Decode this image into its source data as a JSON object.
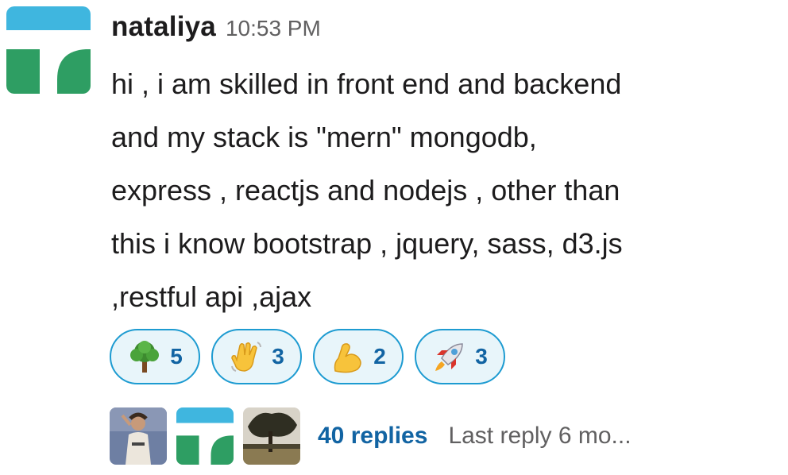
{
  "message": {
    "sender": "nataliya",
    "timestamp": "10:53 PM",
    "text": "hi , i am skilled in front end and backend\nand my stack is \"mern\" mongodb,\nexpress , reactjs and nodejs , other than\nthis i know bootstrap , jquery, sass, d3.js\n,restful api ,ajax",
    "avatar_icon": "green-t-logo-avatar"
  },
  "reactions": [
    {
      "emoji": "tree-emoji",
      "count": "5"
    },
    {
      "emoji": "waving-hand-emoji",
      "count": "3"
    },
    {
      "emoji": "flexed-biceps-emoji",
      "count": "2"
    },
    {
      "emoji": "rocket-emoji",
      "count": "3"
    }
  ],
  "thread": {
    "participant_avatars": [
      "person-photo-avatar",
      "green-t-logo-avatar",
      "tree-photo-avatar"
    ],
    "replies_label": "40 replies",
    "last_reply": "Last reply 6 mo..."
  },
  "colors": {
    "accent_blue": "#1264a3",
    "reaction_border": "#1d9bd1",
    "reaction_bg": "#e8f5fa",
    "logo_green": "#2e9e63",
    "logo_blue": "#3fb6df"
  }
}
